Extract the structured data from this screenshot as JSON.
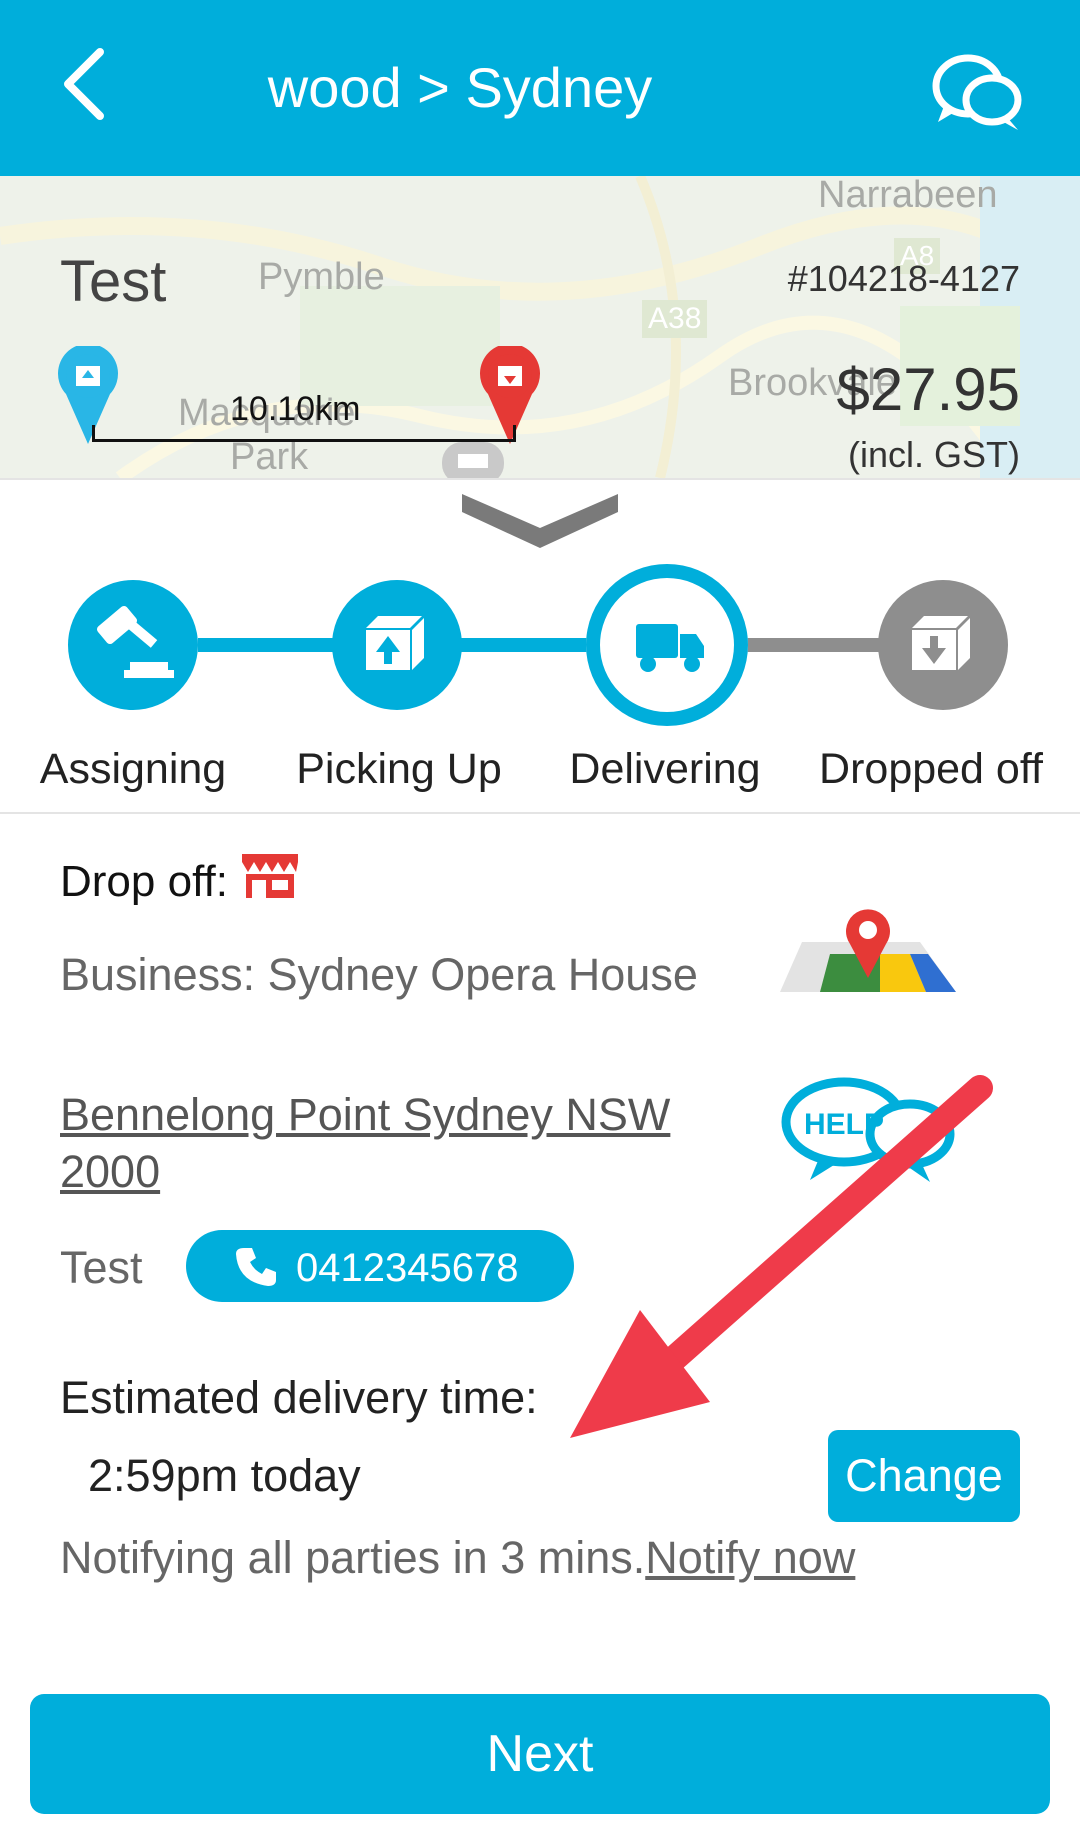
{
  "header": {
    "title": "wood > Sydney",
    "back_icon": "chevron-left-icon",
    "chat_icon": "chat-bubbles-icon"
  },
  "map": {
    "labels": [
      "Narrabeen",
      "Pymble",
      "A38",
      "A8",
      "Brookvale",
      "Macquarie",
      "Park"
    ],
    "order_name": "Test",
    "order_id": "#104218-4127",
    "price": "$27.95",
    "gst": "(incl. GST)",
    "distance": "10.10km"
  },
  "steps": [
    {
      "label": "Assigning",
      "icon": "gavel-icon",
      "state": "done"
    },
    {
      "label": "Picking Up",
      "icon": "box-up-icon",
      "state": "done"
    },
    {
      "label": "Delivering",
      "icon": "truck-icon",
      "state": "current"
    },
    {
      "label": "Dropped off",
      "icon": "box-down-icon",
      "state": "pending"
    }
  ],
  "details": {
    "dropoff_label": "Drop off:",
    "business": "Business: Sydney Opera House",
    "address": "Bennelong Point Sydney NSW 2000",
    "contact_name": "Test",
    "phone": "0412345678",
    "help_label": "HELP",
    "eta_label": "Estimated delivery time:",
    "eta_time": "2:59pm today",
    "change_label": "Change",
    "notify_text": "Notifying all parties in 3 mins.",
    "notify_link": "Notify now"
  },
  "footer": {
    "next_label": "Next"
  },
  "colors": {
    "primary": "#00aedb",
    "pending": "#8e8e8e",
    "pin_red": "#e53935",
    "arrow": "#ef3b4a"
  }
}
